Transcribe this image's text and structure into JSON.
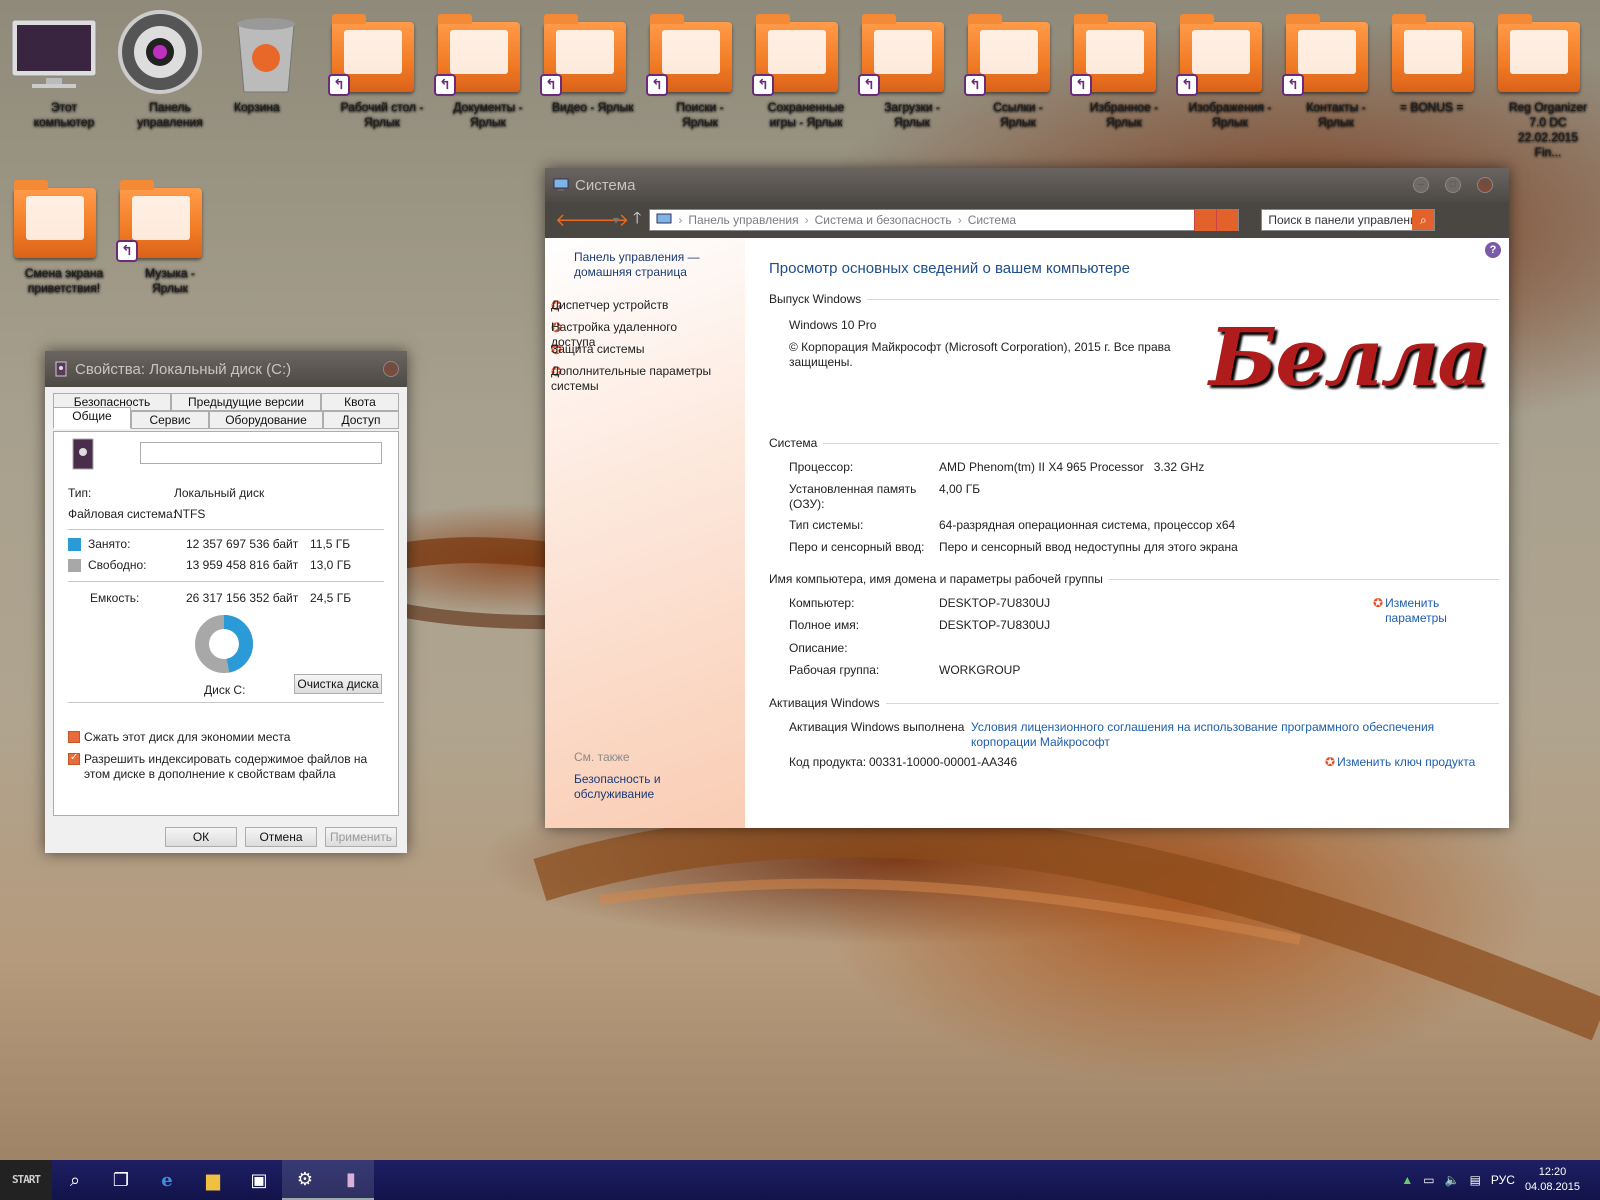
{
  "desktop": {
    "icons_row1": [
      {
        "label": "Этот компьютер",
        "icon": "monitor-icon"
      },
      {
        "label": "Панель управления",
        "icon": "gear-icon"
      },
      {
        "label": "Корзина",
        "icon": "recycle-bin-icon"
      },
      {
        "label": "Рабочий стол - Ярлык",
        "icon": "folder-desktop-icon"
      },
      {
        "label": "Документы - Ярлык",
        "icon": "folder-documents-icon"
      },
      {
        "label": "Видео - Ярлык",
        "icon": "folder-video-icon"
      },
      {
        "label": "Поиски - Ярлык",
        "icon": "folder-search-icon"
      },
      {
        "label": "Сохраненные игры - Ярлык",
        "icon": "folder-games-icon"
      },
      {
        "label": "Загрузки - Ярлык",
        "icon": "folder-downloads-icon"
      },
      {
        "label": "Ссылки - Ярлык",
        "icon": "folder-links-icon"
      },
      {
        "label": "Избранное - Ярлык",
        "icon": "folder-favorites-icon"
      },
      {
        "label": "Изображения - Ярлык",
        "icon": "folder-pictures-icon"
      },
      {
        "label": "Контакты - Ярлык",
        "icon": "folder-contacts-icon"
      },
      {
        "label": "= BONUS =",
        "icon": "folder-icon"
      },
      {
        "label": "Reg Organizer 7.0 DC 22.02.2015 Fin...",
        "icon": "folder-archive-icon"
      }
    ],
    "icons_row2": [
      {
        "label": "Смена экрана приветствия!",
        "icon": "folder-icon"
      },
      {
        "label": "Музыка - Ярлык",
        "icon": "folder-music-icon"
      }
    ]
  },
  "system_window": {
    "title": "Система",
    "address": {
      "crumb1": "Панель управления",
      "crumb2": "Система и безопасность",
      "crumb3": "Система"
    },
    "search_placeholder": "Поиск в панели управления",
    "sidebar": {
      "home": "Панель управления — домашняя страница",
      "links": [
        "Диспетчер устройств",
        "Настройка удаленного доступа",
        "Защита системы",
        "Дополнительные параметры системы"
      ],
      "see_also": "См. также",
      "see_also_link": "Безопасность и обслуживание"
    },
    "page_title": "Просмотр основных сведений о вашем компьютере",
    "windows_edition": {
      "heading": "Выпуск Windows",
      "edition": "Windows 10 Pro",
      "copyright": "© Корпорация Майкрософт (Microsoft Corporation), 2015 г. Все права защищены.",
      "logo_text": "Белла"
    },
    "system": {
      "heading": "Система",
      "rows": [
        {
          "label": "Процессор:",
          "value": "AMD Phenom(tm) II X4 965 Processor   3.32 GHz"
        },
        {
          "label": "Установленная память (ОЗУ):",
          "value": "4,00 ГБ"
        },
        {
          "label": "Тип системы:",
          "value": "64-разрядная операционная система, процессор x64"
        },
        {
          "label": "Перо и сенсорный ввод:",
          "value": "Перо и сенсорный ввод недоступны для этого экрана"
        }
      ]
    },
    "computer_name": {
      "heading": "Имя компьютера, имя домена и параметры рабочей группы",
      "change_link": "Изменить параметры",
      "rows": [
        {
          "label": "Компьютер:",
          "value": "DESKTOP-7U830UJ"
        },
        {
          "label": "Полное имя:",
          "value": "DESKTOP-7U830UJ"
        },
        {
          "label": "Описание:",
          "value": ""
        },
        {
          "label": "Рабочая группа:",
          "value": "WORKGROUP"
        }
      ]
    },
    "activation": {
      "heading": "Активация Windows",
      "status": "Активация Windows выполнена",
      "license_link": "Условия лицензионного соглашения на использование программного обеспечения корпорации Майкрософт",
      "product_key_label": "Код продукта:",
      "product_key": "00331-10000-00001-AA346",
      "change_key_link": "Изменить ключ продукта"
    }
  },
  "disk_window": {
    "title": "Свойства: Локальный диск (C:)",
    "tabs_top": [
      "Безопасность",
      "Предыдущие версии",
      "Квота"
    ],
    "tabs_bottom": [
      "Общие",
      "Сервис",
      "Оборудование",
      "Доступ"
    ],
    "name_value": "",
    "type_label": "Тип:",
    "type_value": "Локальный диск",
    "fs_label": "Файловая система:",
    "fs_value": "NTFS",
    "used": {
      "label": "Занято:",
      "bytes": "12 357 697 536 байт",
      "size": "11,5 ГБ",
      "color": "#2b9bd8"
    },
    "free": {
      "label": "Свободно:",
      "bytes": "13 959 458 816 байт",
      "size": "13,0 ГБ",
      "color": "#a8a8a8"
    },
    "capacity": {
      "label": "Емкость:",
      "bytes": "26 317 156 352 байт",
      "size": "24,5 ГБ"
    },
    "used_fraction": 0.47,
    "disk_label": "Диск C:",
    "cleanup_button": "Очистка диска",
    "compress_label": "Сжать этот диск для экономии места",
    "index_label": "Разрешить индексировать содержимое файлов на этом диске в дополнение к свойствам файла",
    "compress_checked": false,
    "index_checked": true,
    "ok": "ОК",
    "cancel": "Отмена",
    "apply": "Применить"
  },
  "taskbar": {
    "start_label": "START",
    "language": "РУС",
    "time": "12:20",
    "date": "04.08.2015"
  },
  "colors": {
    "accent": "#e86b22",
    "link": "#1e5fae",
    "taskbar": "#1d1f63"
  }
}
